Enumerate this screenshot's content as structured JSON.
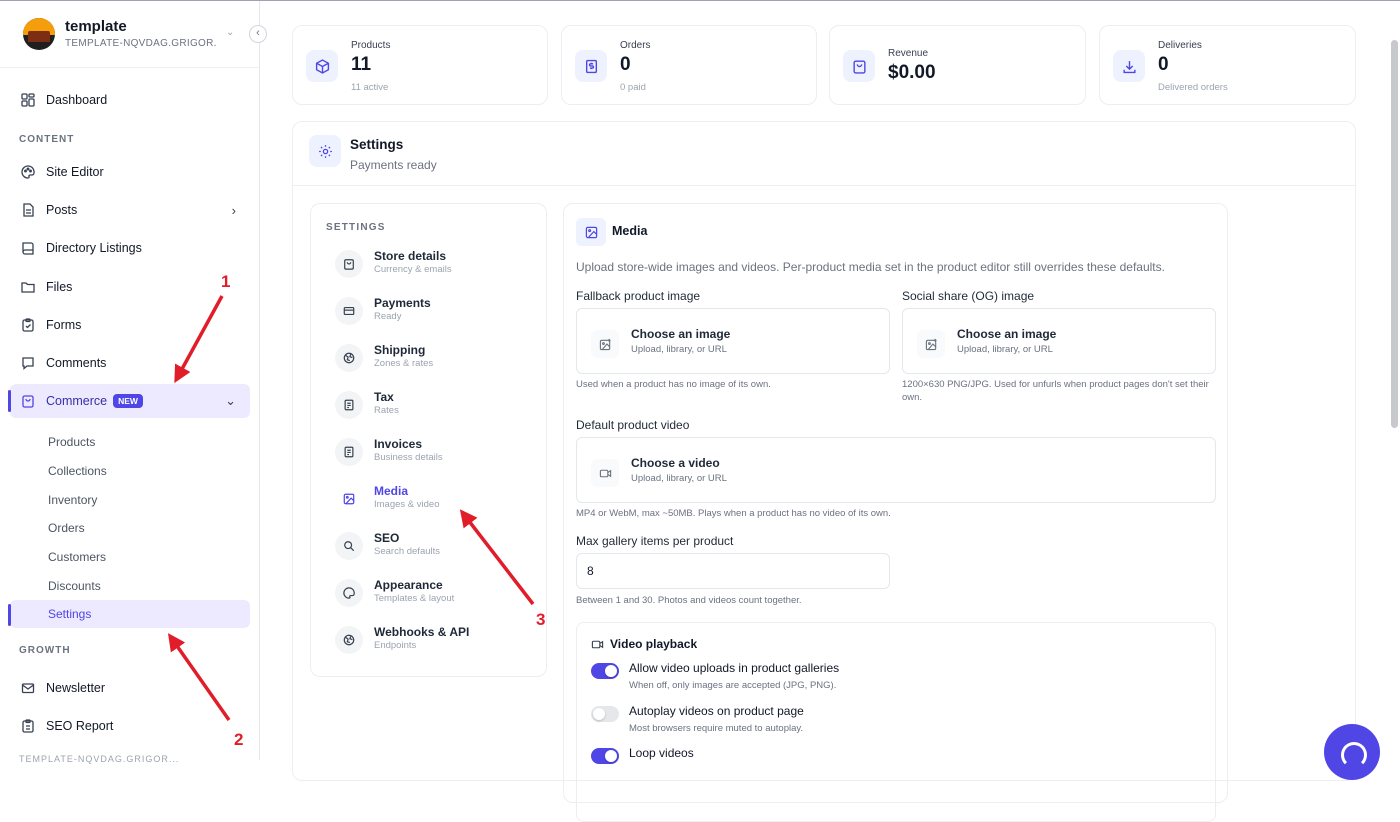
{
  "brand": {
    "name": "template",
    "subtitle": "TEMPLATE-NQVDAG.GRIGOR..."
  },
  "sidebar": {
    "dashboard": "Dashboard",
    "content_label": "CONTENT",
    "site_editor": "Site Editor",
    "posts": "Posts",
    "directory": "Directory Listings",
    "files": "Files",
    "forms": "Forms",
    "comments": "Comments",
    "commerce": "Commerce",
    "commerce_badge": "NEW",
    "commerce_sub": [
      "Products",
      "Collections",
      "Inventory",
      "Orders",
      "Customers",
      "Discounts",
      "Settings"
    ],
    "growth_label": "GROWTH",
    "newsletter": "Newsletter",
    "seo_report": "SEO Report",
    "bottom_faded": "TEMPLATE-NQVDAG.GRIGOR..."
  },
  "stats": [
    {
      "label": "Products",
      "value": "11",
      "note": "11 active"
    },
    {
      "label": "Orders",
      "value": "0",
      "note": "0 paid"
    },
    {
      "label": "Revenue",
      "value": "$0.00",
      "note": ""
    },
    {
      "label": "Deliveries",
      "value": "0",
      "note": "Delivered orders"
    }
  ],
  "settings": {
    "title": "Settings",
    "status": "Payments ready"
  },
  "settings_nav": {
    "heading": "SETTINGS",
    "items": [
      {
        "title": "Store details",
        "sub": "Currency & emails"
      },
      {
        "title": "Payments",
        "sub": "Ready"
      },
      {
        "title": "Shipping",
        "sub": "Zones & rates"
      },
      {
        "title": "Tax",
        "sub": "Rates"
      },
      {
        "title": "Invoices",
        "sub": "Business details"
      },
      {
        "title": "Media",
        "sub": "Images & video"
      },
      {
        "title": "SEO",
        "sub": "Search defaults"
      },
      {
        "title": "Appearance",
        "sub": "Templates & layout"
      },
      {
        "title": "Webhooks & API",
        "sub": "Endpoints"
      }
    ]
  },
  "media": {
    "title": "Media",
    "description": "Upload store-wide images and videos. Per-product media set in the product editor still overrides these defaults.",
    "fallback_label": "Fallback product image",
    "fallback_title": "Choose an image",
    "fallback_sub": "Upload, library, or URL",
    "fallback_help": "Used when a product has no image of its own.",
    "og_label": "Social share (OG) image",
    "og_title": "Choose an image",
    "og_sub": "Upload, library, or URL",
    "og_help": "1200×630 PNG/JPG. Used for unfurls when product pages don't set their own.",
    "video_label": "Default product video",
    "video_title": "Choose a video",
    "video_sub": "Upload, library, or URL",
    "video_help": "MP4 or WebM, max ~50MB. Plays when a product has no video of its own.",
    "gallery_label": "Max gallery items per product",
    "gallery_value": "8",
    "gallery_help": "Between 1 and 30. Photos and videos count together.",
    "playback_title": "Video playback",
    "toggles": [
      {
        "label": "Allow video uploads in product galleries",
        "sub": "When off, only images are accepted (JPG, PNG).",
        "on": true
      },
      {
        "label": "Autoplay videos on product page",
        "sub": "Most browsers require muted to autoplay.",
        "on": false
      },
      {
        "label": "Loop videos",
        "sub": "",
        "on": true
      }
    ]
  },
  "annotations": {
    "one": "1",
    "two": "2",
    "three": "3",
    "color": "#e11d2a"
  },
  "colors": {
    "accent": "#4f46e5",
    "accent_soft": "#ede9fe",
    "annotation": "#e11d2a"
  }
}
